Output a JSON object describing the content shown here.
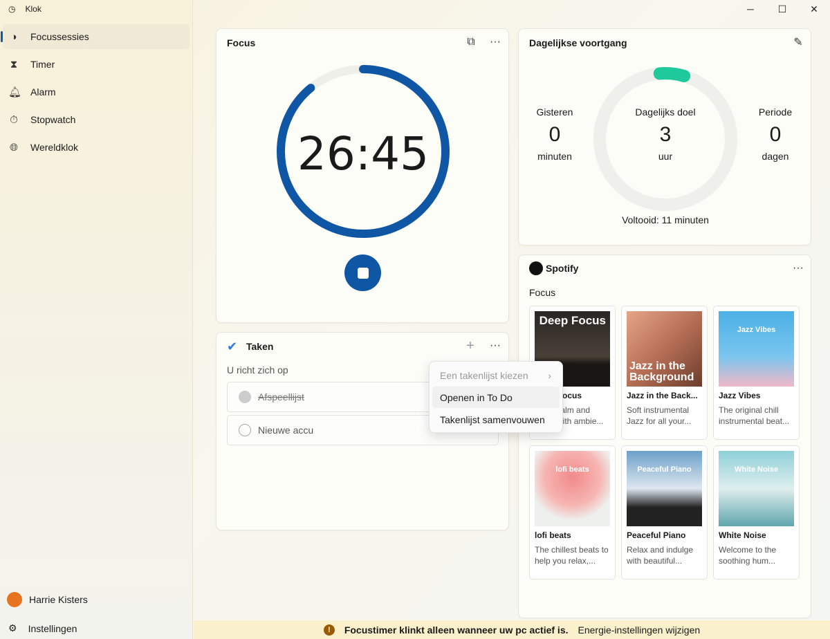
{
  "app": {
    "title": "Klok",
    "window_controls": [
      "minimize",
      "maximize",
      "close"
    ]
  },
  "sidebar": {
    "items": [
      {
        "label": "Focussessies",
        "icon": "focus-icon",
        "active": true
      },
      {
        "label": "Timer",
        "icon": "hourglass-icon"
      },
      {
        "label": "Alarm",
        "icon": "bell-icon"
      },
      {
        "label": "Stopwatch",
        "icon": "stopwatch-icon"
      },
      {
        "label": "Wereldklok",
        "icon": "globe-icon"
      }
    ],
    "user": "Harrie Kisters",
    "settings": "Instellingen"
  },
  "focus": {
    "title": "Focus",
    "time": "26:45",
    "remaining_fraction": 0.89,
    "accent": "#0f56a5"
  },
  "progress": {
    "title": "Dagelijkse voortgang",
    "yesterday_label": "Gisteren",
    "yesterday_value": "0",
    "yesterday_unit": "minuten",
    "goal_label": "Dagelijks doel",
    "goal_value": "3",
    "goal_unit": "uur",
    "period_label": "Periode",
    "period_value": "0",
    "period_unit": "dagen",
    "completed": "Voltooid: 11 minuten",
    "completed_fraction": 0.06,
    "accent": "#1ec99b"
  },
  "tasks": {
    "title": "Taken",
    "subtitle": "U richt zich op",
    "items": [
      {
        "label": "Afspeellijst",
        "done": true
      },
      {
        "label": "Nieuwe accu",
        "done": false
      }
    ]
  },
  "menu": {
    "items": [
      {
        "label": "Een takenlijst kiezen",
        "disabled": true
      },
      {
        "label": "Openen in To Do"
      },
      {
        "label": "Takenlijst samenvouwen"
      }
    ]
  },
  "spotify": {
    "brand": "Spotify",
    "section": "Focus",
    "playlists": [
      {
        "title": "Deep Focus",
        "cover_text": "Deep Focus",
        "desc": "Keep calm and focus with ambie..."
      },
      {
        "title": "Jazz in the Back...",
        "cover_text": "Jazz in the Background",
        "desc": "Soft instrumental Jazz for all your..."
      },
      {
        "title": "Jazz Vibes",
        "cover_text": "Jazz Vibes",
        "desc": "The original chill instrumental beat..."
      },
      {
        "title": "lofi beats",
        "cover_text": "lofi beats",
        "desc": "The chillest beats to help you relax,..."
      },
      {
        "title": "Peaceful Piano",
        "cover_text": "Peaceful Piano",
        "desc": "Relax and indulge with beautiful..."
      },
      {
        "title": "White Noise",
        "cover_text": "White Noise",
        "desc": "Welcome to the soothing hum..."
      }
    ]
  },
  "banner": {
    "message": "Focustimer klinkt alleen wanneer uw pc actief is.",
    "link": "Energie-instellingen wijzigen"
  }
}
